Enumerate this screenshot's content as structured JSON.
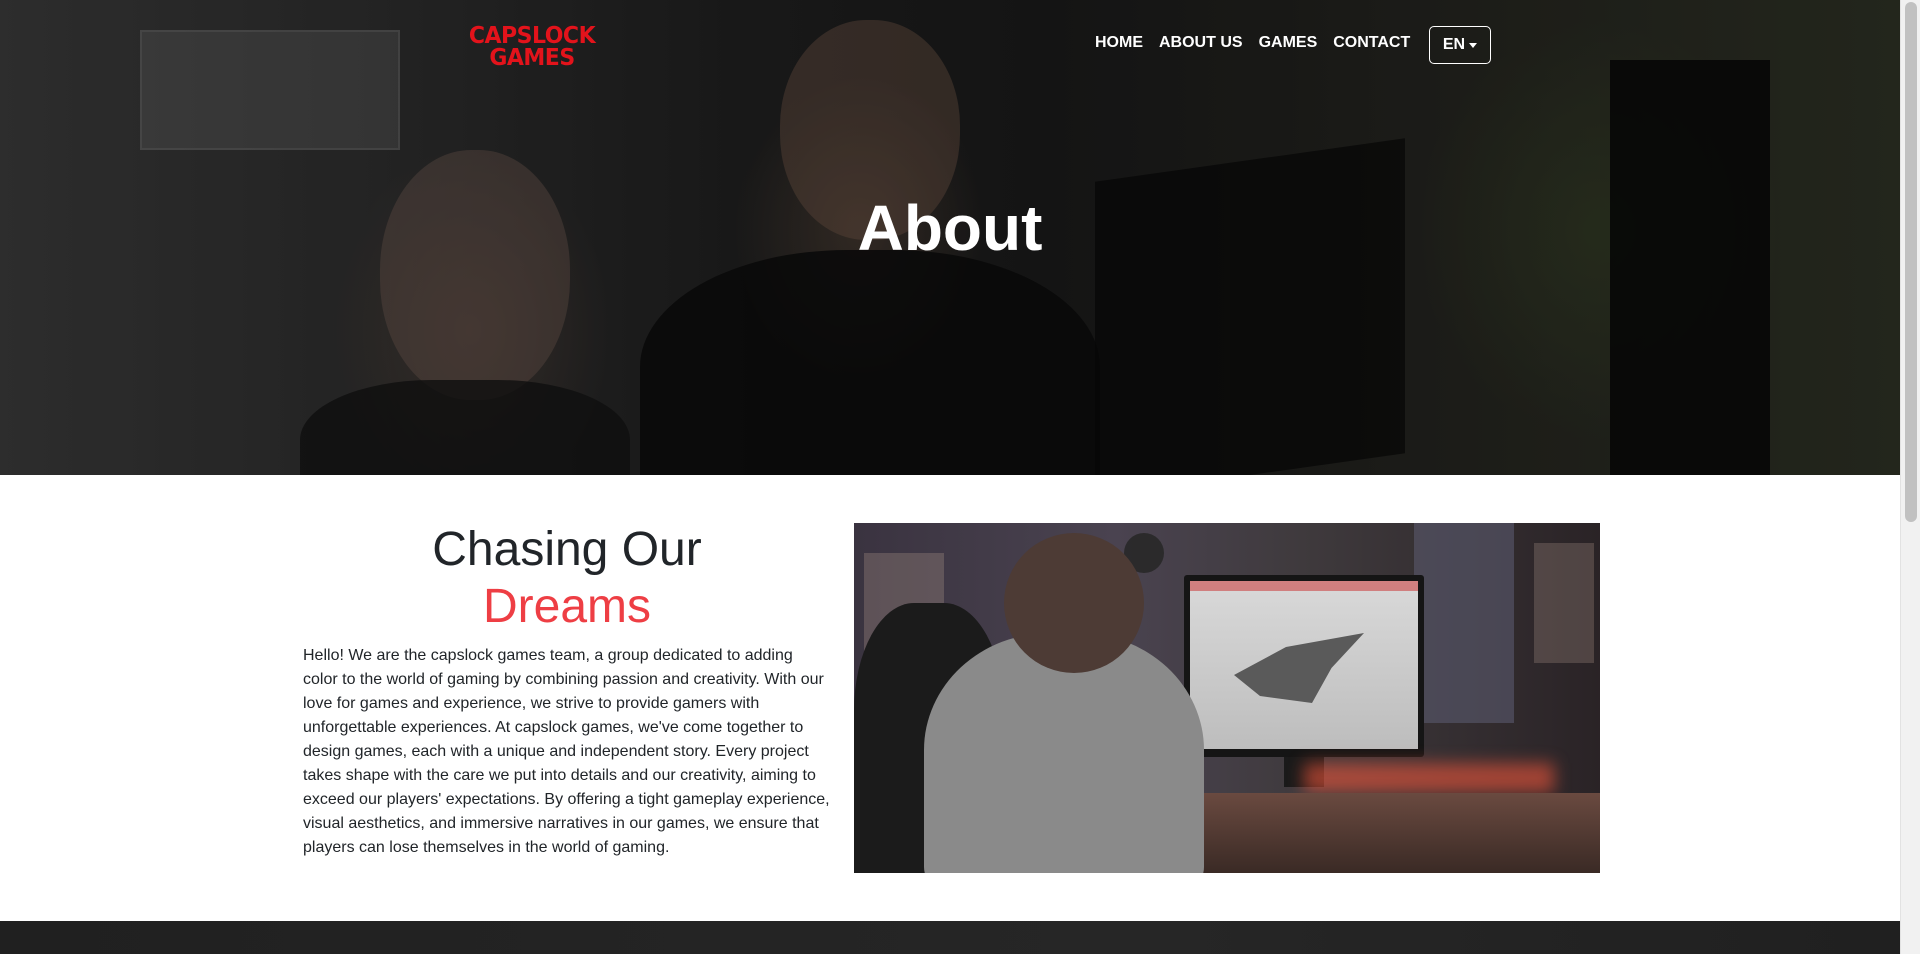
{
  "brand": {
    "logo_line1": "CAPSLOCK",
    "logo_line2": "GAMES",
    "logo_color": "#e3131b"
  },
  "nav": {
    "items": [
      {
        "label": "HOME"
      },
      {
        "label": "ABOUT US"
      },
      {
        "label": "GAMES"
      },
      {
        "label": "CONTACT"
      }
    ],
    "language": {
      "selected": "EN",
      "icon": "chevron-down-icon"
    }
  },
  "hero": {
    "title": "About"
  },
  "about": {
    "heading_line1": "Chasing Our",
    "heading_line2": "Dreams",
    "accent_color": "#ee3e44",
    "paragraph": "Hello! We are the capslock games team, a group dedicated to adding color to the world of gaming by combining passion and creativity. With our love for games and experience, we strive to provide gamers with unforgettable experiences. At capslock games, we've come together to design games, each with a unique and independent story. Every project takes shape with the care we put into details and our creativity, aiming to exceed our players' expectations. By offering a tight gameplay experience, visual aesthetics, and immersive narratives in our games, we ensure that players can lose themselves in the world of gaming."
  }
}
